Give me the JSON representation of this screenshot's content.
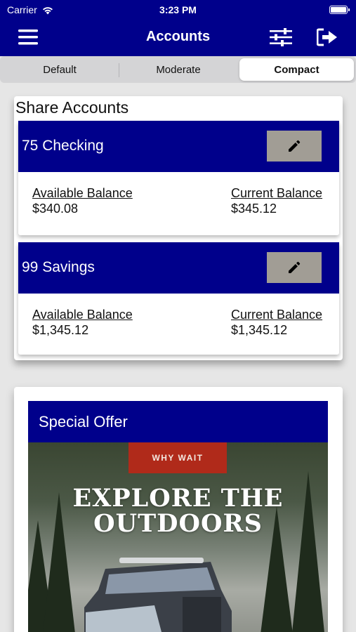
{
  "status_bar": {
    "carrier": "Carrier",
    "time": "3:23 PM"
  },
  "header": {
    "title": "Accounts",
    "icons": [
      "hamburger-menu-icon",
      "sliders-icon",
      "logout-icon"
    ]
  },
  "view_modes": {
    "options": [
      "Default",
      "Moderate",
      "Compact"
    ],
    "selected": "Compact"
  },
  "share_accounts": {
    "title": "Share Accounts",
    "accounts": [
      {
        "name": "75 Checking",
        "available_label": "Available Balance",
        "available": "$340.08",
        "current_label": "Current Balance",
        "current": "$345.12"
      },
      {
        "name": "99 Savings",
        "available_label": "Available Balance",
        "available": "$1,345.12",
        "current_label": "Current Balance",
        "current": "$1,345.12"
      }
    ]
  },
  "special_offer": {
    "title": "Special Offer",
    "badge": "WHY WAIT",
    "headline_1": "EXPLORE THE",
    "headline_2": "OUTDOORS"
  },
  "colors": {
    "brand_navy": "#00008b",
    "edit_button": "#a19d95",
    "badge_red": "#b02a1a",
    "background": "#e6e6e6"
  }
}
